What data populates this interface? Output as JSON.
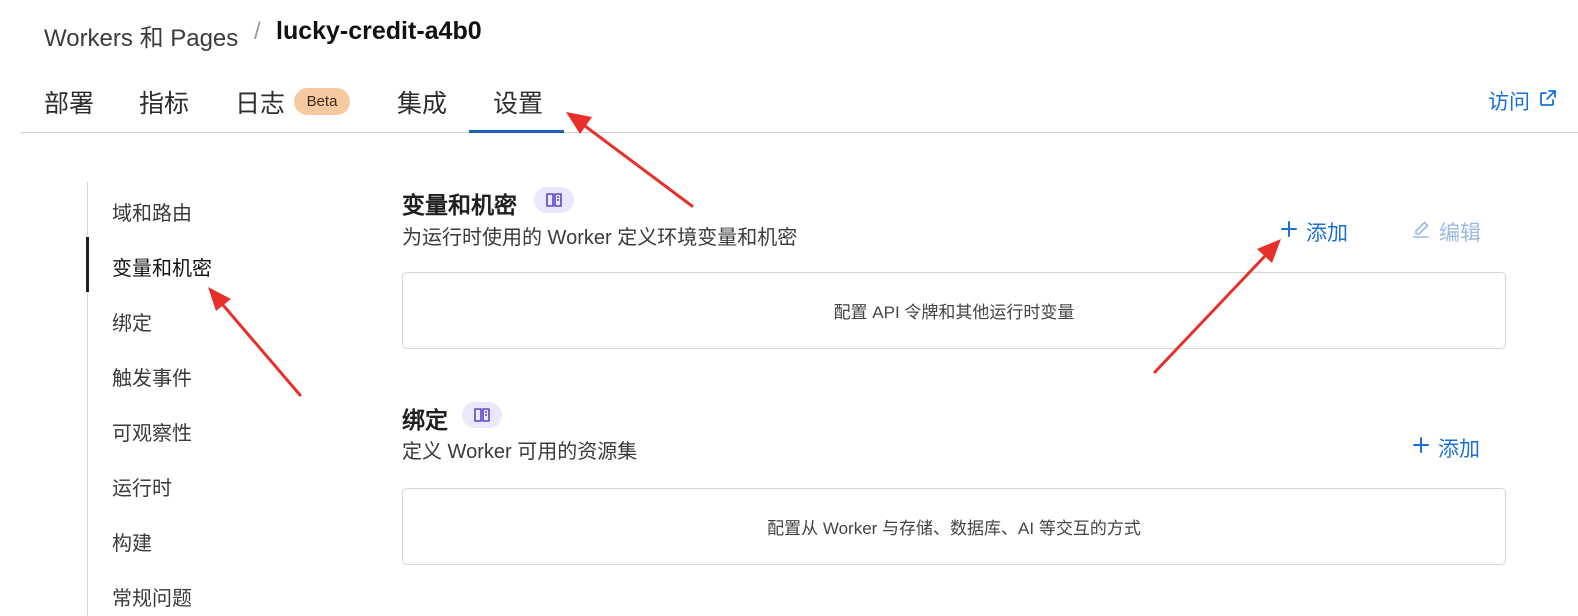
{
  "breadcrumb": {
    "parent": "Workers 和 Pages",
    "separator": "/",
    "current": "lucky-credit-a4b0"
  },
  "tabs": [
    {
      "label": "部署"
    },
    {
      "label": "指标"
    },
    {
      "label": "日志",
      "badge": "Beta"
    },
    {
      "label": "集成"
    },
    {
      "label": "设置",
      "active": true
    }
  ],
  "header": {
    "visit_label": "访问",
    "visit_icon": "external-link-icon"
  },
  "sidebar": {
    "items": [
      {
        "label": "域和路由"
      },
      {
        "label": "变量和机密",
        "active": true
      },
      {
        "label": "绑定"
      },
      {
        "label": "触发事件"
      },
      {
        "label": "可观察性"
      },
      {
        "label": "运行时"
      },
      {
        "label": "构建"
      },
      {
        "label": "常规问题"
      }
    ]
  },
  "sections": {
    "variables": {
      "title": "变量和机密",
      "description": "为运行时使用的 Worker 定义环境变量和机密",
      "add_label": "添加",
      "edit_label": "编辑",
      "empty_text": "配置 API 令牌和其他运行时变量"
    },
    "bindings": {
      "title": "绑定",
      "description": "定义 Worker 可用的资源集",
      "add_label": "添加",
      "empty_text": "配置从 Worker 与存储、数据库、AI 等交互的方式"
    }
  },
  "colors": {
    "accent": "#1a6fd6",
    "tab_underline": "#1d5fb5",
    "beta_badge": "#f6c9a1",
    "doc_badge": "#ece8fb",
    "annotation_arrow": "#e8302a"
  }
}
